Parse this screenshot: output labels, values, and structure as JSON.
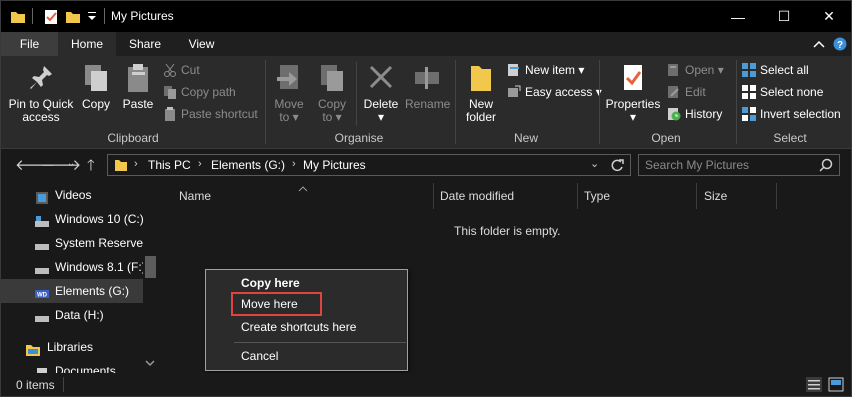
{
  "window": {
    "title": "My Pictures"
  },
  "titlebar": {
    "minimize": "—",
    "maximize": "☐",
    "close": "✕"
  },
  "tabs": {
    "file": "File",
    "home": "Home",
    "share": "Share",
    "view": "View"
  },
  "ribbon": {
    "clipboard": {
      "label": "Clipboard",
      "pin_line1": "Pin to Quick",
      "pin_line2": "access",
      "copy": "Copy",
      "paste": "Paste",
      "cut": "Cut",
      "copy_path": "Copy path",
      "paste_shortcut": "Paste shortcut"
    },
    "organise": {
      "label": "Organise",
      "move_line1": "Move",
      "move_line2": "to",
      "copy_line1": "Copy",
      "copy_line2": "to",
      "delete": "Delete",
      "rename": "Rename"
    },
    "new": {
      "label": "New",
      "new_folder_line1": "New",
      "new_folder_line2": "folder",
      "new_item": "New item",
      "easy_access": "Easy access"
    },
    "open": {
      "label": "Open",
      "properties": "Properties",
      "open": "Open",
      "edit": "Edit",
      "history": "History"
    },
    "select": {
      "label": "Select",
      "select_all": "Select all",
      "select_none": "Select none",
      "invert_selection": "Invert selection"
    }
  },
  "address": {
    "crumbs": [
      "This PC",
      "Elements (G:)",
      "My Pictures"
    ],
    "search_placeholder": "Search My Pictures"
  },
  "nav": {
    "items": [
      {
        "label": "Videos"
      },
      {
        "label": "Windows 10 (C:)"
      },
      {
        "label": "System Reserved"
      },
      {
        "label": "Windows 8.1 (F:)"
      },
      {
        "label": "Elements (G:)"
      },
      {
        "label": "Data (H:)"
      },
      {
        "label": "Libraries"
      },
      {
        "label": "Documents"
      }
    ]
  },
  "columns": {
    "name": "Name",
    "date_modified": "Date modified",
    "type": "Type",
    "size": "Size"
  },
  "content": {
    "empty_message": "This folder is empty."
  },
  "context_menu": {
    "copy_here": "Copy here",
    "move_here": "Move here",
    "create_shortcuts_here": "Create shortcuts here",
    "cancel": "Cancel"
  },
  "status": {
    "items": "0 items"
  },
  "colors": {
    "accent": "#e0443d",
    "folder": "#f1c84b",
    "checkmark": "#e8613c",
    "select_icon": "#4c9bd6"
  }
}
